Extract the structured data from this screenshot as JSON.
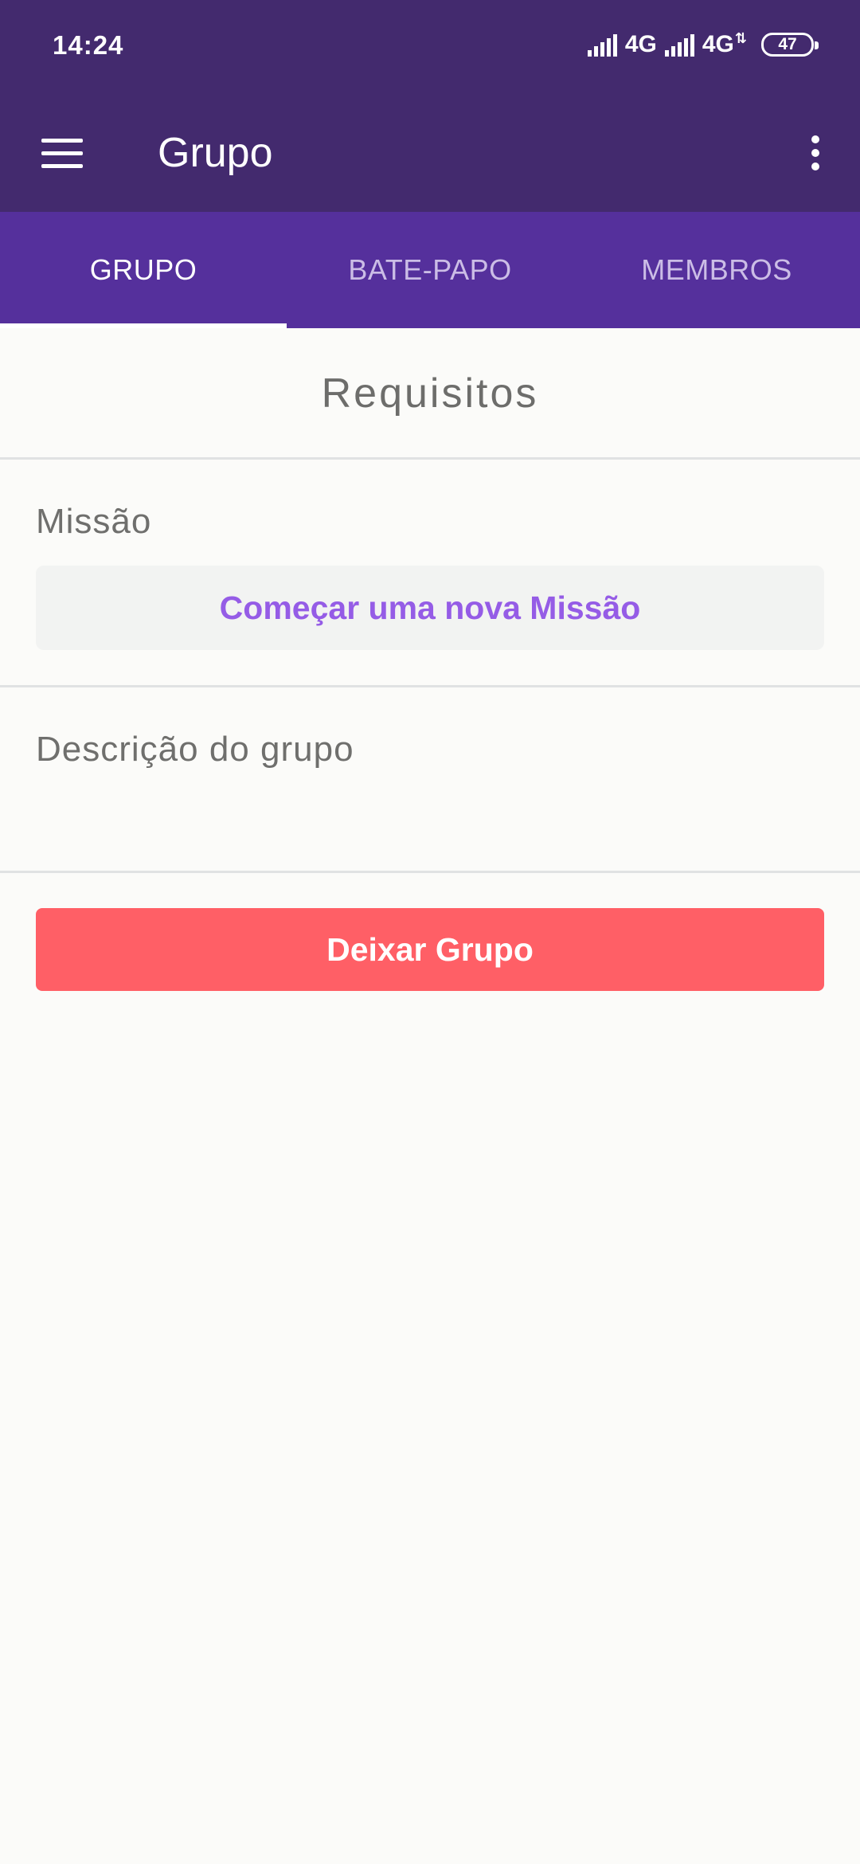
{
  "status_bar": {
    "time": "14:24",
    "network_1": "4G",
    "network_2": "4G",
    "battery": "47"
  },
  "app_bar": {
    "title": "Grupo",
    "menu_icon": "hamburger-menu-icon",
    "overflow_icon": "more-vert-icon"
  },
  "tabs": [
    {
      "label": "GRUPO",
      "active": true
    },
    {
      "label": "BATE-PAPO",
      "active": false
    },
    {
      "label": "MEMBROS",
      "active": false
    }
  ],
  "main": {
    "section_title": "Requisitos",
    "mission_label": "Missão",
    "start_quest_label": "Começar uma nova Missão",
    "description_label": "Descrição do grupo",
    "leave_group_label": "Deixar Grupo"
  },
  "colors": {
    "app_bar": "#432a6e",
    "tab_bar": "#55309c",
    "accent_text": "#955ce6",
    "danger": "#ff5f66",
    "background": "#fbfbf9"
  }
}
